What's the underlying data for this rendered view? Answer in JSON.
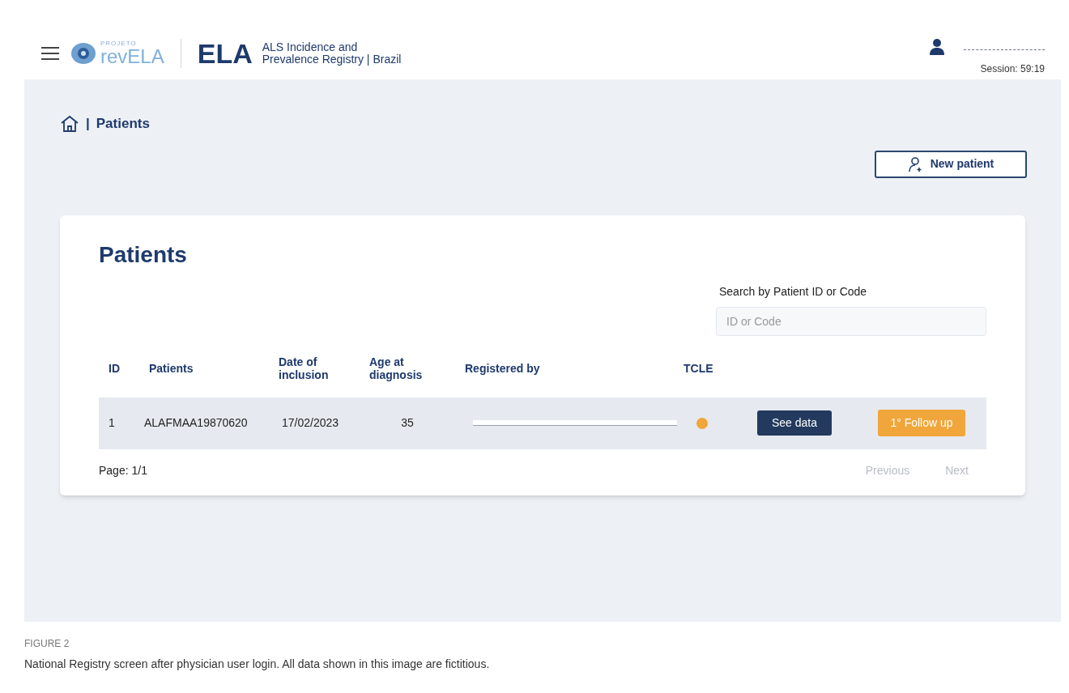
{
  "header": {
    "logo_prefix": "PROJETO",
    "logo_text": "revELA",
    "brand": "ELA",
    "subtitle_line1": "ALS Incidence and",
    "subtitle_line2": "Prevalence Registry | Brazil",
    "user": {
      "name_redacted": true
    },
    "session": "Session: 59:19"
  },
  "breadcrumb": {
    "separator": "|",
    "current": "Patients"
  },
  "new_patient_button": "New patient",
  "card": {
    "title": "Patients",
    "search": {
      "label": "Search by Patient ID or Code",
      "placeholder": "ID or Code"
    },
    "table": {
      "columns": [
        "ID",
        "Patients",
        "Date of inclusion",
        "Age at diagnosis",
        "Registered by",
        "TCLE"
      ],
      "rows": [
        {
          "id": "1",
          "patient": "ALAFMAA19870620",
          "date": "17/02/2023",
          "age": "35",
          "registered_by_redacted": true,
          "color": "#f0a63a",
          "see_button": "See data",
          "follow_button": "1° Follow up"
        }
      ]
    },
    "page": "Page: 1/1",
    "pager": [
      {
        "label": "Previous",
        "disabled": true
      },
      {
        "label": "Next",
        "disabled": true
      }
    ]
  },
  "figure": {
    "label": "FIGURE 2",
    "caption": "National Registry screen after physician user login. All data shown in this image are fictitious."
  }
}
